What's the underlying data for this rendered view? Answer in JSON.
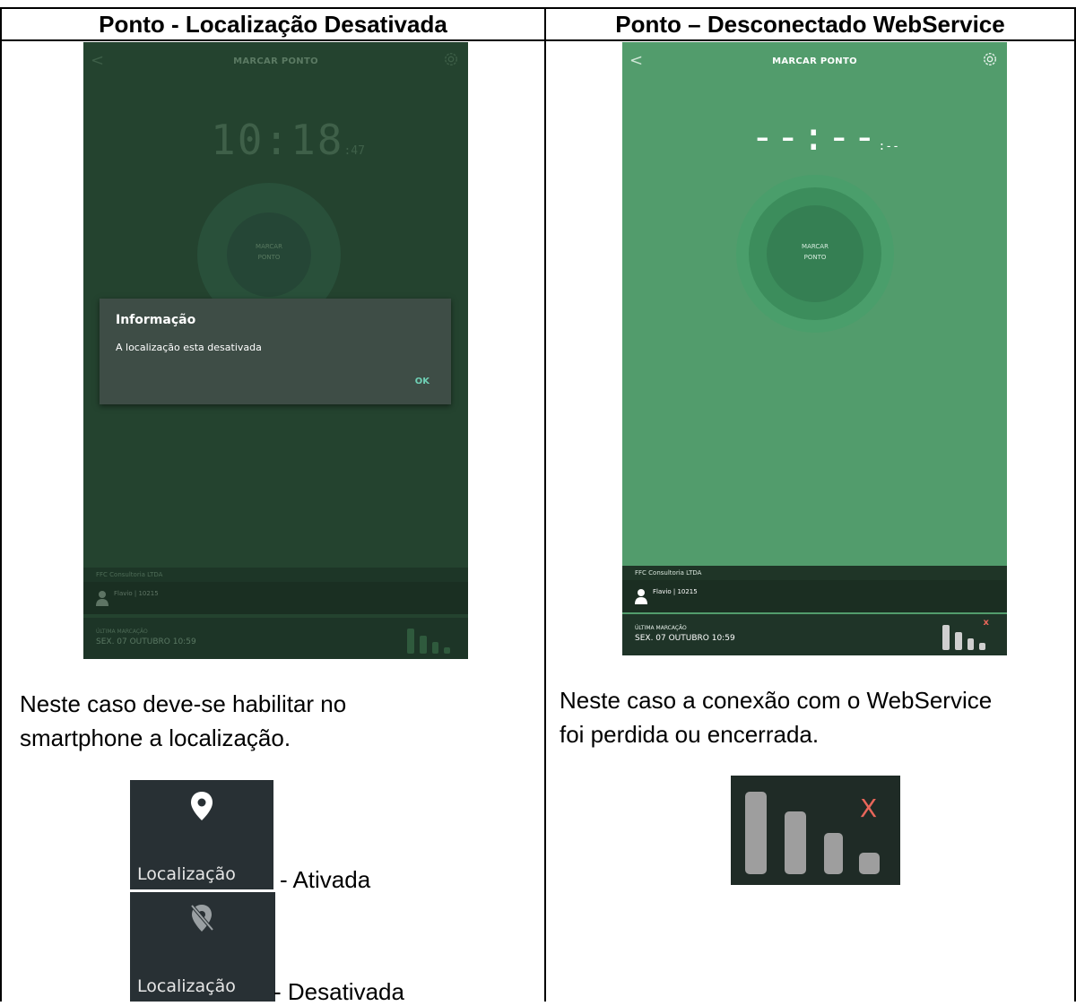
{
  "table": {
    "left_header": "Ponto - Localização Desativada",
    "right_header": "Ponto – Desconectado WebService"
  },
  "phone_left": {
    "title": "MARCAR PONTO",
    "clock_hm": "10:18",
    "clock_s": ":47",
    "button_line1": "MARCAR",
    "button_line2": "PONTO",
    "dialog": {
      "title": "Informação",
      "message": "A localização esta desativada",
      "ok": "OK"
    },
    "company": "FFC Consultoria LTDA",
    "user": "Flavio | 10215",
    "last_label": "ÚLTIMA MARCAÇÃO",
    "last_value": "SEX. 07 OUTUBRO 10:59"
  },
  "phone_right": {
    "title": "MARCAR PONTO",
    "clock_hm": "--:--",
    "clock_s": ":--",
    "button_line1": "MARCAR",
    "button_line2": "PONTO",
    "company": "FFC Consultoria LTDA",
    "user": "Flavio | 10215",
    "last_label": "ÚLTIMA MARCAÇÃO",
    "last_value": "SEX. 07 OUTUBRO 10:59",
    "signal_x": "x"
  },
  "left_description": {
    "line1": "Neste caso deve-se habilitar no",
    "line2": "smartphone a localização."
  },
  "right_description": {
    "line1": "Neste caso a conexão com o WebService",
    "line2": "foi perdida ou encerrada."
  },
  "location_on": {
    "label": "Localização",
    "caption": "- Ativada"
  },
  "location_off": {
    "label": "Localização",
    "caption": "- Desativada"
  },
  "signal_big": {
    "mark": "X"
  },
  "colors": {
    "phone_left_bg": "#24432f",
    "phone_right_bg": "#529c6c",
    "dialog_bg": "#3e4d46",
    "ok_accent": "#6fd0b5",
    "signal_x": "#e8665a"
  }
}
